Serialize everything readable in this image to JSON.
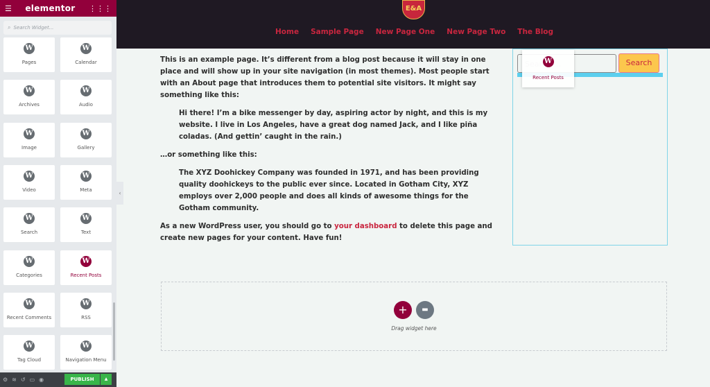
{
  "panel": {
    "brand": "elementor",
    "search_placeholder": "Search Widget...",
    "widgets": [
      "Pages",
      "Calendar",
      "Archives",
      "Audio",
      "Image",
      "Gallery",
      "Video",
      "Meta",
      "Search",
      "Text",
      "Categories",
      "Recent Posts",
      "Recent Comments",
      "RSS",
      "Tag Cloud",
      "Navigation Menu"
    ],
    "active_widget": "Recent Posts",
    "publish_label": "PUBLISH"
  },
  "site": {
    "logo_text": "E&A",
    "nav": [
      "Home",
      "Sample Page",
      "New Page One",
      "New Page Two",
      "The Blog"
    ]
  },
  "content": {
    "p1": "This is an example page. It’s different from a blog post because it will stay in one place and will show up in your site navigation (in most themes). Most people start with an About page that introduces them to potential site visitors. It might say something like this:",
    "q1": "Hi there! I’m a bike messenger by day, aspiring actor by night, and this is my website. I live in Los Angeles, have a great dog named Jack, and I like piña coladas. (And gettin’ caught in the rain.)",
    "p2": "…or something like this:",
    "q2": "The XYZ Doohickey Company was founded in 1971, and has been providing quality doohickeys to the public ever since. Located in Gotham City, XYZ employs over 2,000 people and does all kinds of awesome things for the Gotham community.",
    "p3_before": "As a new WordPress user, you should go to ",
    "p3_link": "your dashboard",
    "p3_after": " to delete this page and create new pages for your content. Have fun!"
  },
  "sidebar": {
    "search_placeholder": "Search …",
    "search_button": "Search",
    "dragging_label": "Recent Posts"
  },
  "dropzone": {
    "text": "Drag widget here"
  },
  "colors": {
    "elementor": "#92003b",
    "header": "#1f1923",
    "link": "#c9263f",
    "publish": "#39b54a"
  }
}
